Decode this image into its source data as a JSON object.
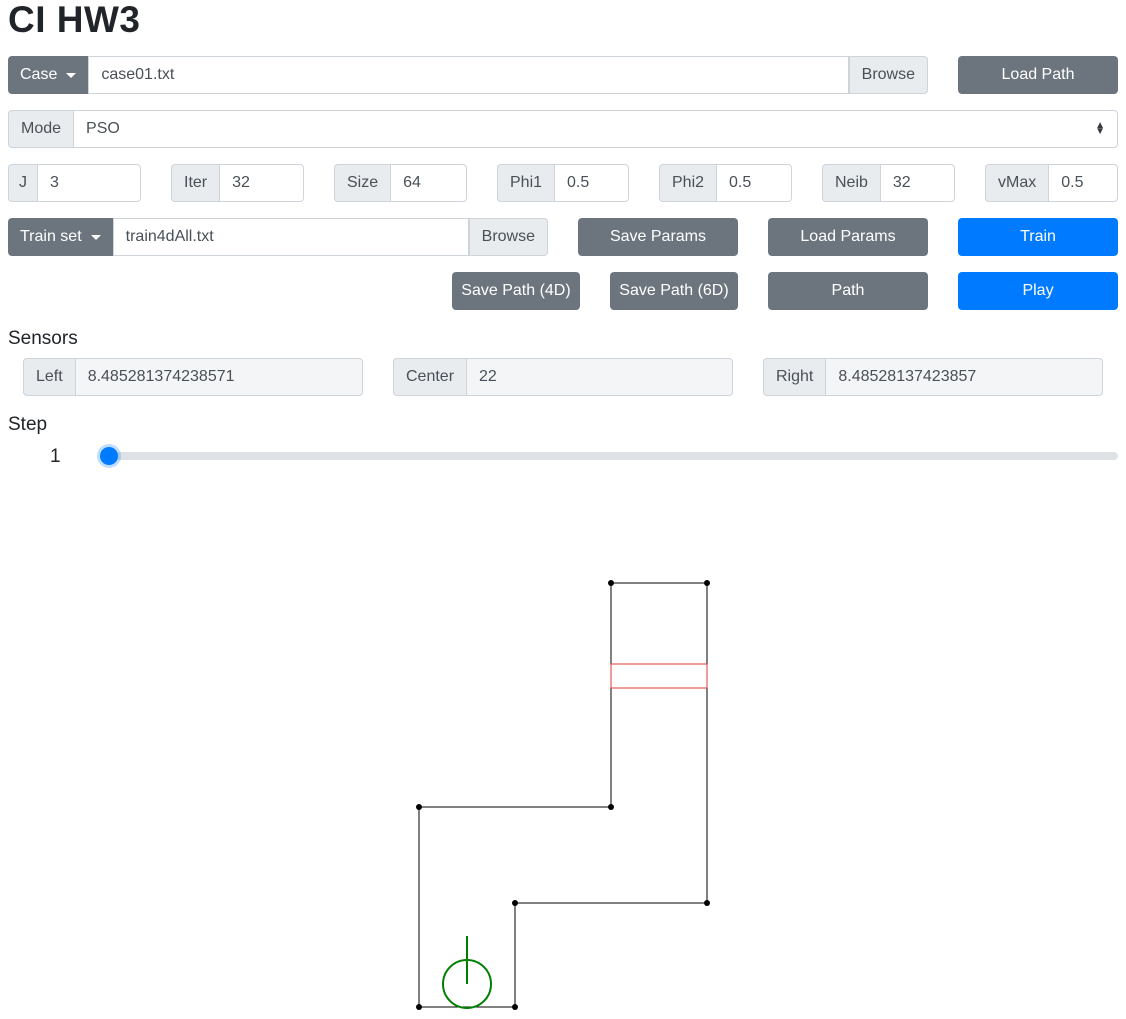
{
  "title": "CI HW3",
  "case": {
    "dropdown_label": "Case",
    "file_value": "case01.txt",
    "browse_label": "Browse",
    "load_path_label": "Load Path"
  },
  "mode": {
    "label": "Mode",
    "selected": "PSO"
  },
  "params": [
    {
      "label": "J",
      "value": "3"
    },
    {
      "label": "Iter",
      "value": "32"
    },
    {
      "label": "Size",
      "value": "64"
    },
    {
      "label": "Phi1",
      "value": "0.5"
    },
    {
      "label": "Phi2",
      "value": "0.5"
    },
    {
      "label": "Neib",
      "value": "32"
    },
    {
      "label": "vMax",
      "value": "0.5"
    }
  ],
  "train_set": {
    "dropdown_label": "Train set",
    "file_value": "train4dAll.txt",
    "browse_label": "Browse",
    "save_params_label": "Save Params",
    "load_params_label": "Load Params",
    "train_label": "Train"
  },
  "path_actions": {
    "save_4d_label": "Save Path (4D)",
    "save_6d_label": "Save Path (6D)",
    "path_label": "Path",
    "play_label": "Play"
  },
  "sensors": {
    "heading": "Sensors",
    "left_label": "Left",
    "left_value": "8.485281374238571",
    "center_label": "Center",
    "center_value": "22",
    "right_label": "Right",
    "right_value": "8.48528137423857"
  },
  "step": {
    "heading": "Step",
    "value": "1",
    "slider_fraction": 0
  },
  "colors": {
    "primary": "#007bff",
    "secondary": "#6c757d",
    "wall": "#000000",
    "goal": "#e53935",
    "car": "#008000"
  }
}
